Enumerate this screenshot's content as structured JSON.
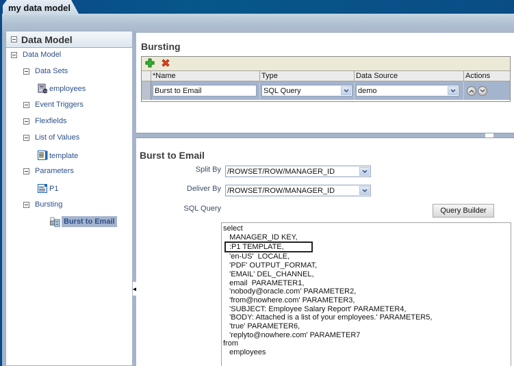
{
  "window": {
    "tab_title": "my data model"
  },
  "sidebar": {
    "header": "Data Model",
    "tree": [
      {
        "label": "Data Model",
        "type": "root"
      },
      {
        "label": "Data Sets",
        "type": "folder"
      },
      {
        "label": "employees",
        "type": "dataset",
        "icon": "dataset-icon"
      },
      {
        "label": "Event Triggers",
        "type": "folder"
      },
      {
        "label": "Flexfields",
        "type": "folder"
      },
      {
        "label": "List of Values",
        "type": "folder"
      },
      {
        "label": "template",
        "type": "lov",
        "icon": "list-of-values-icon"
      },
      {
        "label": "Parameters",
        "type": "folder"
      },
      {
        "label": "P1",
        "type": "parameter",
        "icon": "parameter-icon"
      },
      {
        "label": "Bursting",
        "type": "folder"
      },
      {
        "label": "Burst to Email",
        "type": "bursting",
        "icon": "bursting-icon",
        "selected": true
      }
    ]
  },
  "bursting": {
    "title": "Bursting",
    "toolbar": {
      "add_icon": "add-icon",
      "delete_icon": "delete-icon"
    },
    "columns": [
      "*Name",
      "Type",
      "Data Source",
      "Actions"
    ],
    "rows": [
      {
        "name": "Burst to Email",
        "type": "SQL Query",
        "data_source": "demo",
        "actions": [
          "move-up-icon",
          "move-down-icon"
        ]
      }
    ]
  },
  "detail": {
    "title": "Burst to Email",
    "split_by_label": "Split By",
    "split_by_value": "/ROWSET/ROW/MANAGER_ID",
    "deliver_by_label": "Deliver By",
    "deliver_by_value": "/ROWSET/ROW/MANAGER_ID",
    "sql_query_label": "SQL Query",
    "query_builder_label": "Query Builder",
    "sql_lines": [
      "select",
      "   MANAGER_ID KEY,",
      ":P1 TEMPLATE,",
      "   'en-US'  LOCALE,",
      "   'PDF' OUTPUT_FORMAT,",
      "   'EMAIL' DEL_CHANNEL,",
      "   email  PARAMETER1,",
      "   'nobody@oracle.com' PARAMETER2,",
      "   'from@nowhere.com' PARAMETER3,",
      "   'SUBJECT: Employee Salary Report' PARAMETER4,",
      "   'BODY: Attached is a list of your employees.' PARAMETER5,",
      "   'true' PARAMETER6,",
      "   'replyto@nowhere.com' PARAMETER7",
      "from",
      "   employees"
    ],
    "highlighted_line_index": 2
  }
}
